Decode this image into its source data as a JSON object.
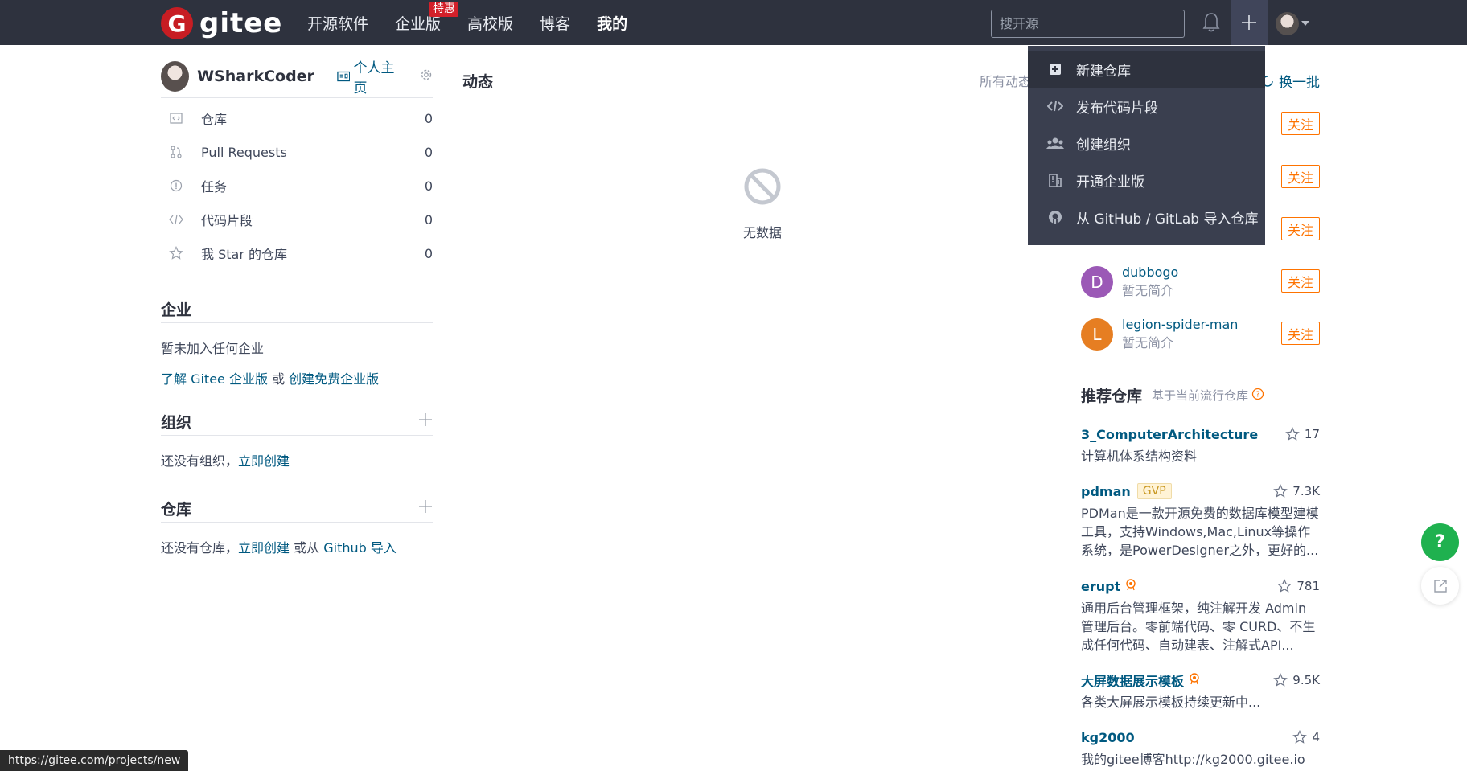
{
  "nav": {
    "logo_mark": "G",
    "logo_text": "gitee",
    "links": [
      "开源软件",
      "企业版",
      "高校版",
      "博客",
      "我的"
    ],
    "hot_badge": "特惠",
    "search_placeholder": "搜开源"
  },
  "dropdown": {
    "items": [
      "新建仓库",
      "发布代码片段",
      "创建组织",
      "开通企业版",
      "从 GitHub / GitLab 导入仓库"
    ]
  },
  "profile": {
    "name": "WSharkCoder",
    "home_link": "个人主页"
  },
  "stats": [
    {
      "label": "仓库",
      "count": "0"
    },
    {
      "label": "Pull Requests",
      "count": "0"
    },
    {
      "label": "任务",
      "count": "0"
    },
    {
      "label": "代码片段",
      "count": "0"
    },
    {
      "label": "我 Star 的仓库",
      "count": "0"
    }
  ],
  "enterprise": {
    "title": "企业",
    "empty": "暂未加入任何企业",
    "learn_link": "了解 Gitee 企业版",
    "or": " 或 ",
    "create_link": "创建免费企业版"
  },
  "orgs": {
    "title": "组织",
    "empty_prefix": "还没有组织，",
    "create_link": "立即创建"
  },
  "repos": {
    "title": "仓库",
    "empty_prefix": "还没有仓库，",
    "create_link": "立即创建",
    "or_from": " 或从 ",
    "import_link": "Github 导入"
  },
  "feed": {
    "title": "动态",
    "filter": "所有动态",
    "empty": "无数据"
  },
  "recommend_users": {
    "refresh": "换一批",
    "follow_label": "关注",
    "users": [
      {
        "name": "dubbogo",
        "bio": "暂无简介",
        "initial": "D",
        "color": "#9b59b6"
      },
      {
        "name": "legion-spider-man",
        "bio": "暂无简介",
        "initial": "L",
        "color": "#e67e22"
      }
    ]
  },
  "recommend_repos": {
    "title": "推荐仓库",
    "subtitle": "基于当前流行仓库",
    "repos": [
      {
        "name": "3_ComputerArchitecture",
        "stars": "17",
        "desc": "计算机体系结构资料",
        "badge": ""
      },
      {
        "name": "pdman",
        "stars": "7.3K",
        "desc": "PDMan是一款开源免费的数据库模型建模工具，支持Windows,Mac,Linux等操作系统，是PowerDesigner之外，更好的...",
        "badge": "GVP"
      },
      {
        "name": "erupt",
        "stars": "781",
        "desc": "通用后台管理框架，纯注解开发 Admin 管理后台。零前端代码、零 CURD、不生成任何代码、自动建表、注解式API...",
        "badge": ""
      },
      {
        "name": "大屏数据展示模板",
        "stars": "9.5K",
        "desc": "各类大屏展示模板持续更新中...",
        "badge": ""
      },
      {
        "name": "kg2000",
        "stars": "4",
        "desc": "我的gitee博客http://kg2000.gitee.io",
        "badge": ""
      }
    ]
  },
  "floating": {
    "help": "?"
  },
  "status_bar": {
    "url": "https://gitee.com/projects/new"
  }
}
